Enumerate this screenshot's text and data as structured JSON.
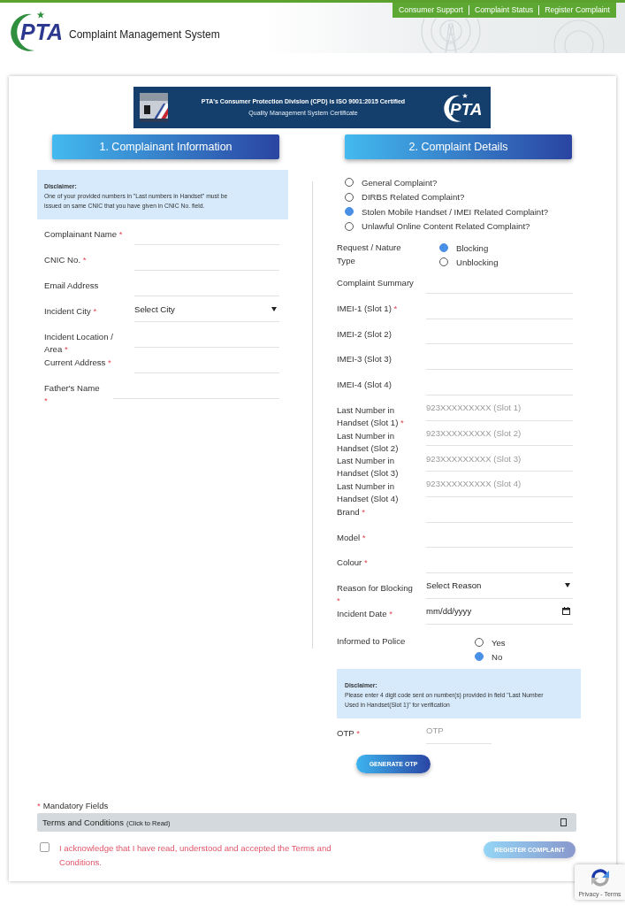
{
  "header": {
    "nav_links": [
      "Consumer Support",
      "Complaint Status",
      "Register Complaint"
    ],
    "logo_text": "PTA",
    "title": "Complaint Management System"
  },
  "banner": {
    "headline": "PTA's Consumer Protection Division (CPD) is ISO 9001:2015 Certified",
    "subline": "Quality Management System Certificate",
    "logo_text": "PTA"
  },
  "complainant": {
    "heading": "1. Complainant Information",
    "disclaimer": {
      "title": "Disclaimer:",
      "text": "One of your provided numbers in \"Last numbers in Handset\" must be issued on same CNIC that you have given in CNIC No. field."
    },
    "fields": [
      {
        "kind": "text",
        "label": "Complainant Name",
        "required_mark": "*"
      },
      {
        "kind": "text",
        "label": "CNIC No.",
        "required_mark": "*"
      },
      {
        "kind": "text",
        "label": "Email Address"
      },
      {
        "kind": "select",
        "label": "Incident City",
        "required_mark": "*",
        "value": "Select City"
      },
      {
        "kind": "text",
        "label": "Incident Location / Area",
        "required_mark": "*"
      },
      {
        "kind": "text",
        "label": "Current Address",
        "required_mark": "*"
      },
      {
        "kind": "text",
        "label": "Father's Name",
        "required_mark": "*"
      }
    ]
  },
  "details": {
    "heading": "2. Complaint Details",
    "complaint_types": [
      {
        "label": "General Complaint?",
        "selected": false
      },
      {
        "label": "DIRBS Related Complaint?",
        "selected": false
      },
      {
        "label": "Stolen Mobile Handset / IMEI Related Complaint?",
        "selected": true
      },
      {
        "label": "Unlawful Online Content Related Complaint?",
        "selected": false
      }
    ],
    "request_type": {
      "label": "Request / Nature Type",
      "options": [
        {
          "label": "Blocking",
          "selected": true
        },
        {
          "label": "Unblocking",
          "selected": false
        }
      ]
    },
    "fields": [
      {
        "kind": "text",
        "label": "Complaint Summary"
      },
      {
        "kind": "text",
        "label": "IMEI-1 (Slot 1)",
        "required_mark": "*"
      },
      {
        "kind": "text",
        "label": "IMEI-2 (Slot 2)"
      },
      {
        "kind": "text",
        "label": "IMEI-3 (Slot 3)"
      },
      {
        "kind": "text",
        "label": "IMEI-4 (Slot 4)"
      },
      {
        "kind": "text",
        "label": "Last Number in Handset (Slot 1)",
        "required_mark": "*",
        "placeholder": "923XXXXXXXXX (Slot 1)"
      },
      {
        "kind": "text",
        "label": "Last Number in Handset (Slot 2)",
        "placeholder": "923XXXXXXXXX (Slot 2)"
      },
      {
        "kind": "text",
        "label": "Last Number in Handset (Slot 3)",
        "placeholder": "923XXXXXXXXX (Slot 3)"
      },
      {
        "kind": "text",
        "label": "Last Number in Handset (Slot 4)",
        "placeholder": "923XXXXXXXXX (Slot 4)"
      },
      {
        "kind": "text",
        "label": "Brand",
        "required_mark": "*"
      },
      {
        "kind": "text",
        "label": "Model",
        "required_mark": "*"
      },
      {
        "kind": "text",
        "label": "Colour",
        "required_mark": "*"
      },
      {
        "kind": "select",
        "label": "Reason for Blocking",
        "required_mark": "*",
        "value": "Select Reason"
      },
      {
        "kind": "date",
        "label": "Incident Date",
        "required_mark": "*",
        "placeholder": "mm/dd/yyyy"
      },
      {
        "kind": "radio",
        "label": "Informed to Police",
        "options": [
          {
            "label": "Yes",
            "selected": false
          },
          {
            "label": "No",
            "selected": true
          }
        ]
      }
    ],
    "disclaimer": {
      "title": "Disclaimer:",
      "text": "Please enter 4 digit code sent on number(s) provided in field \"Last Number Used in Handset(Slot 1)\" for verification"
    },
    "otp": {
      "label": "OTP",
      "required_mark": "*",
      "placeholder": "OTP"
    },
    "generate_button": {
      "label": "GENERATE OTP"
    }
  },
  "footer": {
    "mandatory": {
      "mark": "*",
      "text": "Mandatory Fields"
    },
    "terms": {
      "title": "Terms and Conditions",
      "hint": "(Click to Read)"
    },
    "acknowledge": {
      "checked": false,
      "text": "I acknowledge that I have read, understood and accepted the Terms and Conditions."
    },
    "register_button": {
      "label": "REGISTER COMPLAINT",
      "disabled": true
    }
  },
  "recaptcha": {
    "links": "Privacy - Terms"
  }
}
